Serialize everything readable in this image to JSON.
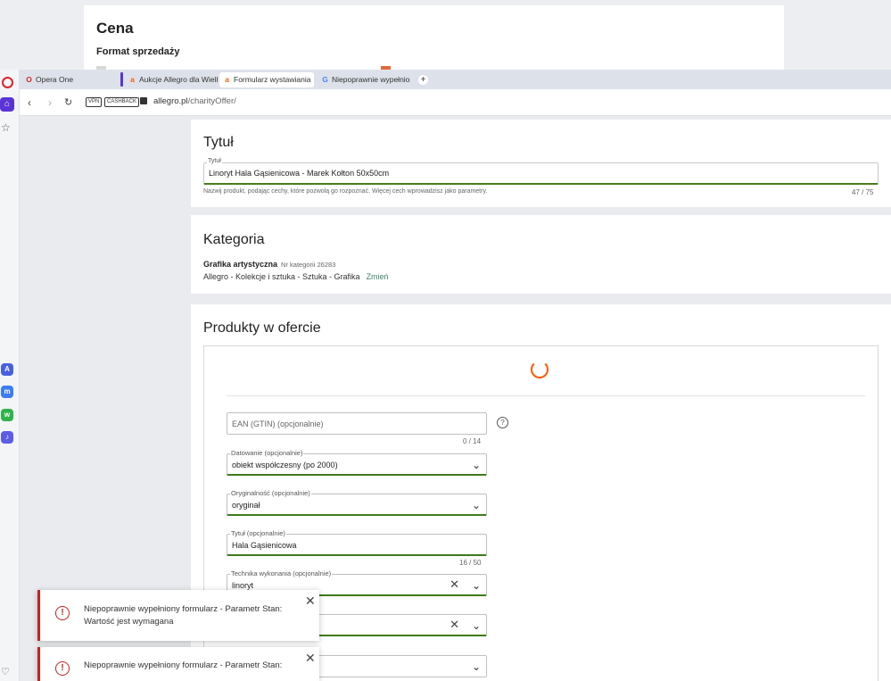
{
  "background_page": {
    "heading": "Cena",
    "subheading": "Format sprzedaży"
  },
  "browser": {
    "tabs": [
      {
        "icon": "opera-icon",
        "label": "Opera One"
      },
      {
        "icon": "allegro-icon",
        "label": "Aukcje Allegro dla Wielkie"
      },
      {
        "icon": "allegro-icon",
        "label": "Formularz wystawiania"
      },
      {
        "icon": "google-icon",
        "label": "Niepoprawnie wypełniony"
      }
    ],
    "new_tab": "+",
    "vpn_label": "VPN",
    "cashback_label": "CASHBACK",
    "url_domain": "allegro.pl",
    "url_path": "/charityOffer/"
  },
  "tytul": {
    "heading": "Tytuł",
    "field_label": "Tytuł",
    "value": "Linoryt Hala Gąsienicowa - Marek Kołton 50x50cm",
    "hint": "Nazwij produkt, podając cechy, które pozwolą go rozpoznać. Więcej cech wprowadzisz jako parametry.",
    "counter": "47 / 75"
  },
  "kategoria": {
    "heading": "Kategoria",
    "name": "Grafika artystyczna",
    "number": "Nr kategorii 26283",
    "path": "Allegro - Kolekcje i sztuka - Sztuka - Grafika",
    "change_link": "Zmień"
  },
  "produkty": {
    "heading": "Produkty w ofercie",
    "ean_placeholder": "EAN (GTIN) (opcjonalnie)",
    "ean_counter": "0 / 14",
    "help": "?",
    "datowanie_label": "Datowanie (opcjonalnie)",
    "datowanie_value": "obiekt współczesny (po 2000)",
    "oryginalnosc_label": "Oryginalność (opcjonalnie)",
    "oryginalnosc_value": "oryginał",
    "tytul_label": "Tytuł (opcjonalnie)",
    "tytul_value": "Hala Gąsienicowa",
    "tytul_counter": "16 / 50",
    "technika_label": "Technika wykonania (opcjonalnie)",
    "technika_value": "linoryt"
  },
  "toasts": [
    {
      "message": "Niepoprawnie wypełniony formularz - Parametr Stan: Wartość jest wymagana",
      "close": "✕"
    },
    {
      "message": "Niepoprawnie wypełniony formularz - Parametr Stan:",
      "close": "✕"
    }
  ],
  "colors": {
    "opera_red": "#e0202c",
    "allegro_orange": "#ff5a00",
    "valid_green": "#3e7a1c",
    "error_red": "#c72121",
    "link_teal": "#3f7e6b"
  }
}
